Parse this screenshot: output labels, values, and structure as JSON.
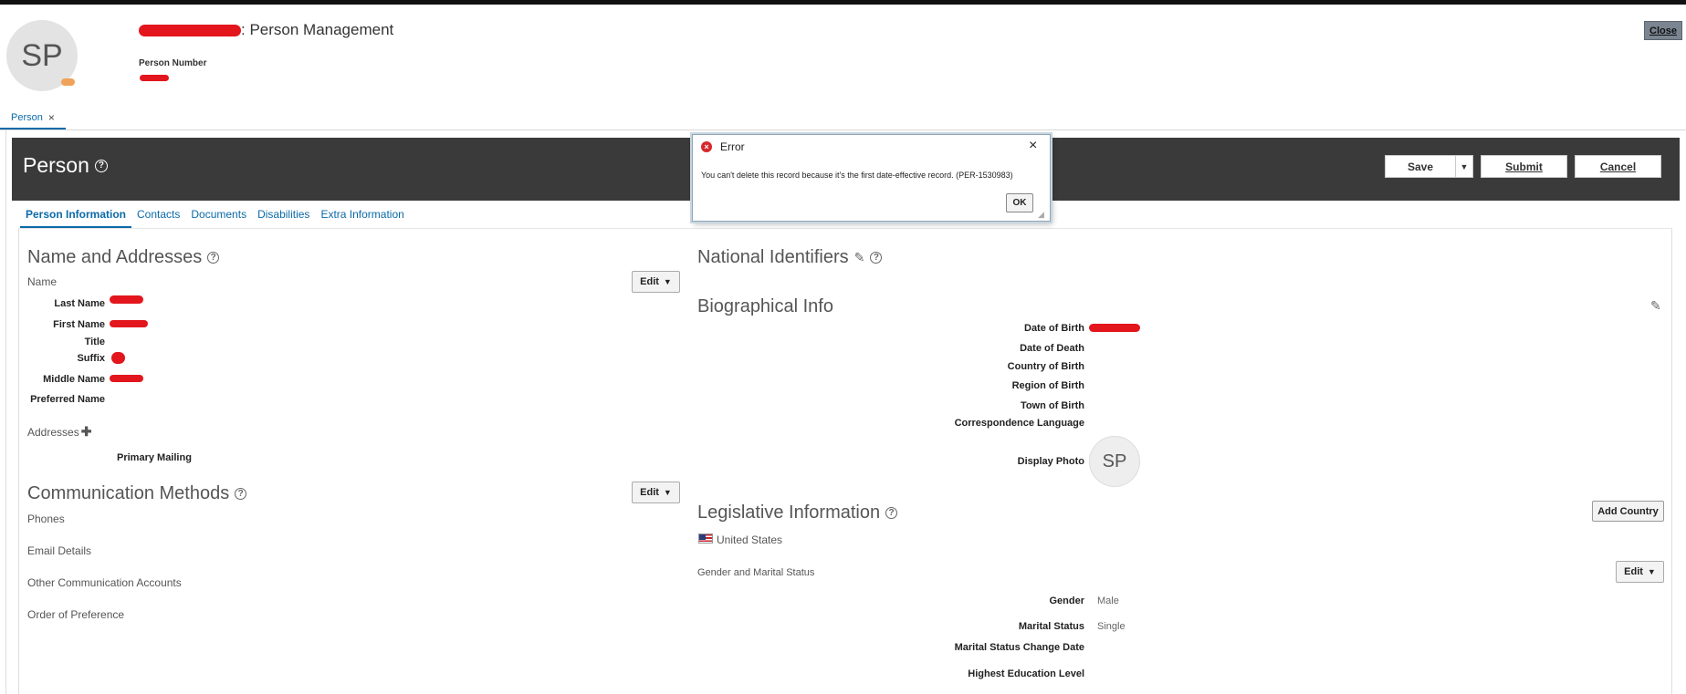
{
  "header": {
    "avatar_initials": "SP",
    "title_suffix": ": Person Management",
    "person_number_label": "Person Number",
    "close_label": "Close"
  },
  "page_tab": {
    "label": "Person",
    "close_glyph": "×"
  },
  "page": {
    "title": "Person",
    "save_label": "Save",
    "submit_label": "Submit",
    "cancel_label": "Cancel"
  },
  "sub_tabs": [
    {
      "label": "Person Information",
      "active": true
    },
    {
      "label": "Contacts"
    },
    {
      "label": "Documents"
    },
    {
      "label": "Disabilities"
    },
    {
      "label": "Extra Information"
    }
  ],
  "name_addresses": {
    "title": "Name and Addresses",
    "name_label": "Name",
    "edit_label": "Edit",
    "fields": {
      "last_name": "Last Name",
      "first_name": "First Name",
      "title": "Title",
      "suffix": "Suffix",
      "middle_name": "Middle Name",
      "preferred_name": "Preferred Name"
    },
    "addresses_label": "Addresses",
    "primary_mailing": "Primary Mailing"
  },
  "communication": {
    "title": "Communication Methods",
    "edit_label": "Edit",
    "phones": "Phones",
    "email": "Email Details",
    "other": "Other Communication Accounts",
    "order": "Order of Preference"
  },
  "national_identifiers": {
    "title": "National Identifiers"
  },
  "biographical": {
    "title": "Biographical Info",
    "date_of_birth": "Date of Birth",
    "date_of_death": "Date of Death",
    "country_of_birth": "Country of Birth",
    "region_of_birth": "Region of Birth",
    "town_of_birth": "Town of Birth",
    "correspondence_language": "Correspondence Language",
    "display_photo": "Display Photo",
    "photo_initials": "SP"
  },
  "legislative": {
    "title": "Legislative Information",
    "add_country_label": "Add Country",
    "country": "United States",
    "gender_marital_label": "Gender and Marital Status",
    "edit_label": "Edit",
    "gender_label": "Gender",
    "gender_value": "Male",
    "marital_status_label": "Marital Status",
    "marital_status_value": "Single",
    "marital_change_date_label": "Marital Status Change Date",
    "highest_education_label": "Highest Education Level"
  },
  "dialog": {
    "title": "Error",
    "message": "You can't delete this record because it's the first date-effective record. (PER-1530983)",
    "ok_label": "OK",
    "close_glyph": "×"
  },
  "colors": {
    "accent": "#0b6aa8",
    "dark_band": "#3a3a3a",
    "error": "#d7272d",
    "redaction": "#e2161c"
  }
}
